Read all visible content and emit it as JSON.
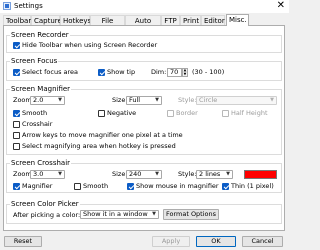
{
  "window": {
    "title": "Settings",
    "close_glyph": "✕"
  },
  "tabs": [
    {
      "label": "Toolbar"
    },
    {
      "label": "Capture"
    },
    {
      "label": "Hotkeys"
    },
    {
      "label": "File Name"
    },
    {
      "label": "Auto Save"
    },
    {
      "label": "FTP"
    },
    {
      "label": "Print"
    },
    {
      "label": "Editor"
    },
    {
      "label": "Misc."
    }
  ],
  "active_tab": "Misc.",
  "screen_recorder": {
    "title": "Screen Recorder",
    "hide_toolbar": {
      "label": "Hide Toolbar when using Screen Recorder",
      "checked": true
    }
  },
  "screen_focus": {
    "title": "Screen Focus",
    "select_focus_area": {
      "label": "Select focus area",
      "checked": true
    },
    "show_tip": {
      "label": "Show tip",
      "checked": true
    },
    "dim_label": "Dim:",
    "dim_value": "70",
    "dim_range": "(30 - 100)"
  },
  "screen_magnifier": {
    "title": "Screen Magnifier",
    "zoom_label": "Zoom:",
    "zoom_value": "2.0",
    "size_label": "Size:",
    "size_value": "Full",
    "style_label": "Style:",
    "style_value": "Circle",
    "smooth": {
      "label": "Smooth",
      "checked": true
    },
    "negative": {
      "label": "Negative",
      "checked": false
    },
    "border": {
      "label": "Border",
      "checked": false
    },
    "half_height": {
      "label": "Half Height",
      "checked": false
    },
    "crosshair": {
      "label": "Crosshair",
      "checked": false
    },
    "arrow_keys": {
      "label": "Arrow keys to move magnifier one pixel at a time",
      "checked": false
    },
    "select_area": {
      "label": "Select magnifying area when hotkey is pressed",
      "checked": false
    }
  },
  "screen_crosshair": {
    "title": "Screen Crosshair",
    "zoom_label": "Zoom:",
    "zoom_value": "3.0",
    "size_label": "Size:",
    "size_value": "240",
    "style_label": "Style:",
    "style_value": "2 lines",
    "color": "#ff0000",
    "magnifier": {
      "label": "Magnifier",
      "checked": true
    },
    "smooth": {
      "label": "Smooth",
      "checked": false
    },
    "show_mouse": {
      "label": "Show mouse in magnifier",
      "checked": true
    },
    "thin": {
      "label": "Thin (1 pixel)",
      "checked": true
    }
  },
  "screen_color_picker": {
    "title": "Screen Color Picker",
    "after_label": "After picking a color:",
    "after_value": "Show it in a window",
    "format_button": "Format Options"
  },
  "footer": {
    "reset": "Reset",
    "apply": "Apply",
    "ok": "OK",
    "cancel": "Cancel"
  },
  "colors": {
    "accent": "#0b5cc6",
    "default_border": "#0067c0"
  }
}
